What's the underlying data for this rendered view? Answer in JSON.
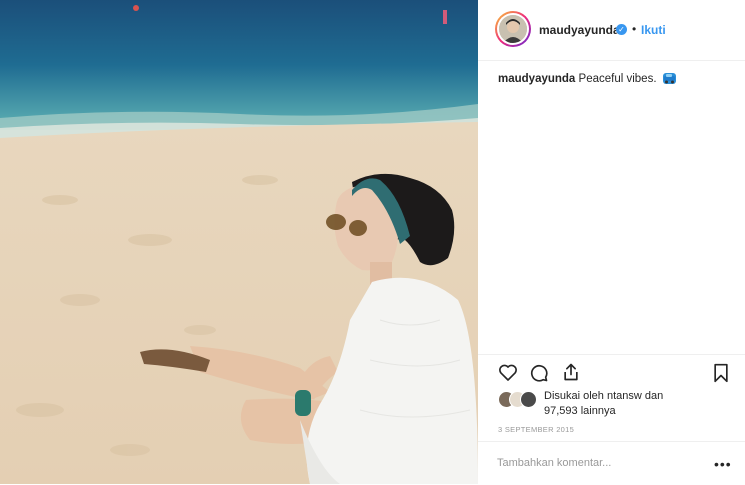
{
  "post": {
    "username": "maudyayunda",
    "verified_icon": "verified-badge-icon",
    "separator": "•",
    "follow_label": "Ikuti",
    "caption_username": "maudyayunda",
    "caption_text": "Peaceful vibes.",
    "caption_emoji": "car-emoji-icon",
    "likes_prefix": "Disukai oleh",
    "likes_user": "ntansw",
    "likes_suffix": "dan",
    "likes_count": "97,593",
    "likes_others": "lainnya",
    "date": "3 SEPTEMBER 2015",
    "comment_placeholder": "Tambahkan komentar...",
    "more_label": "•••"
  },
  "actions": {
    "icons": [
      "heart-icon",
      "comment-icon",
      "share-icon",
      "bookmark-icon"
    ]
  },
  "colors": {
    "link_blue": "#3897f0",
    "text": "#262626",
    "muted": "#999999",
    "border": "#efefef"
  }
}
